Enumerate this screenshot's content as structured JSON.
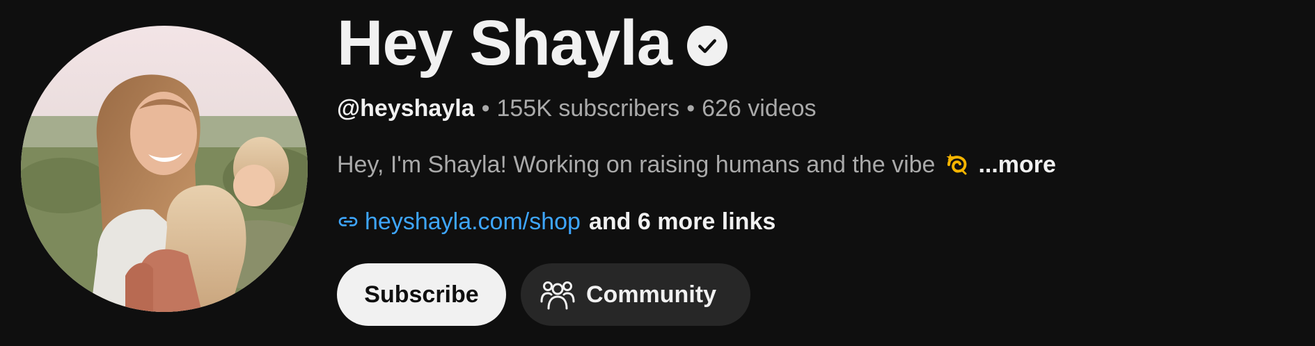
{
  "channel": {
    "name": "Hey Shayla",
    "verified_icon": "check-circle-icon",
    "handle": "@heyshayla",
    "subscribers": "155K subscribers",
    "videos": "626 videos",
    "separator": "•",
    "description": "Hey, I'm Shayla! Working on raising humans and the vibe",
    "description_emoji": "dizzy-icon",
    "more_label": "...more",
    "link_icon": "link-icon",
    "link_url": "heyshayla.com/shop",
    "more_links": "and 6 more links"
  },
  "actions": {
    "subscribe_label": "Subscribe",
    "community_label": "Community",
    "community_icon": "people-icon"
  },
  "colors": {
    "background": "#0f0f0f",
    "primary_text": "#f1f1f1",
    "secondary_text": "#aaaaaa",
    "link": "#3ea6ff",
    "subscribe_bg": "#f1f1f1",
    "community_bg": "#272727"
  }
}
